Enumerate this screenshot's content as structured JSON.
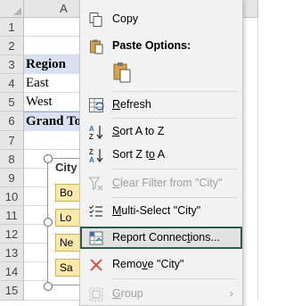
{
  "spreadsheet": {
    "column_headers": [
      "A"
    ],
    "row_numbers": [
      "1",
      "2",
      "3",
      "4",
      "5",
      "6",
      "7",
      "8",
      "9",
      "10",
      "11",
      "12",
      "13",
      "14",
      "15"
    ],
    "cells": {
      "a3": "Region",
      "a4": "East",
      "a5": "West",
      "a6": "Grand To"
    }
  },
  "slicer": {
    "title": "City",
    "items": [
      "Bo",
      "Lo",
      "Ne",
      "Sa"
    ]
  },
  "context_menu": {
    "items": {
      "copy": "Copy",
      "paste_options": "Paste Options:",
      "refresh": "Refresh",
      "sort_az": "Sort A to Z",
      "sort_za": "Sort Z to A",
      "clear_filter": "Clear Filter from \"City\"",
      "multi_select": "Multi-Select \"City\"",
      "report_connections": "Report Connections...",
      "remove": "Remove \"City\"",
      "group": "Group"
    },
    "icons": {
      "copy": "copy-icon",
      "paste": "clipboard-icon",
      "refresh": "refresh-icon",
      "sort_az": "sort-ascending-icon",
      "sort_za": "sort-descending-icon",
      "clear_filter": "clear-filter-icon",
      "multi_select": "multi-select-icon",
      "report_connections": "report-connections-icon",
      "remove": "remove-x-icon",
      "group": "group-icon",
      "submenu": "chevron-right-icon"
    },
    "highlight_color": "#2d5a4e"
  },
  "colors": {
    "header_fill": "#d9e1f2",
    "slicer_item_fill": "#fde9a9",
    "remove_icon": "#e03b3b",
    "sort_icon": "#2f6fb3"
  }
}
